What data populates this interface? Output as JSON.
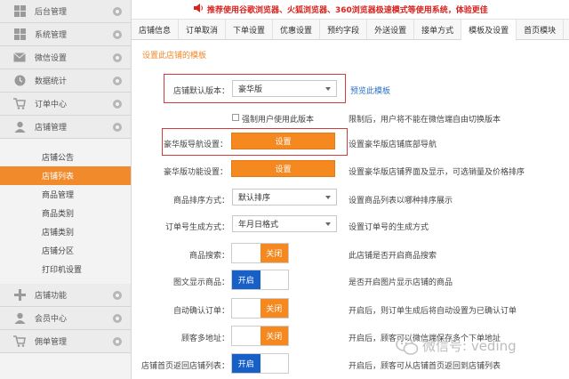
{
  "notice": {
    "text": "推荐使用谷歌浏览器、火狐浏览器、360浏览器极速模式等使用系统，体验更佳",
    "icon": "speaker-icon"
  },
  "sidebar": {
    "groups": [
      {
        "label": "后台管理",
        "icon": "grid-icon"
      },
      {
        "label": "系统管理",
        "icon": "grid-icon"
      },
      {
        "label": "微信设置",
        "icon": "mail-icon"
      },
      {
        "label": "数据统计",
        "icon": "clock-icon"
      },
      {
        "label": "订单中心",
        "icon": "cart-icon"
      },
      {
        "label": "店铺管理",
        "icon": "user-icon"
      }
    ],
    "sub_items": [
      "店铺公告",
      "店铺列表",
      "商品管理",
      "商品类别",
      "店铺类别",
      "店铺分区",
      "打印机设置"
    ],
    "active_sub": "店铺列表",
    "bottom_groups": [
      {
        "label": "店铺功能",
        "icon": "plus-icon"
      },
      {
        "label": "会员中心",
        "icon": "user-icon"
      },
      {
        "label": "佣单管理",
        "icon": "cart-icon"
      }
    ]
  },
  "tabs": [
    "店铺信息",
    "订单取消",
    "下单设置",
    "优惠设置",
    "预约字段",
    "外送设置",
    "接单方式",
    "模板及设置",
    "首页模块"
  ],
  "active_tab": "模板及设置",
  "section_link": "设置此店铺的模板",
  "form": {
    "default_version": {
      "label": "店铺默认版本：",
      "value": "豪华版",
      "preview_link": "预览此模板"
    },
    "force_version": {
      "label": "强制用户使用此版本",
      "desc": "限制后，用户将不能在微信端自由切换版本"
    },
    "nav_setting": {
      "label": "豪华版导航设置：",
      "button": "设置",
      "desc": "设置豪华版店铺底部导航"
    },
    "func_setting": {
      "label": "豪华版功能设置：",
      "button": "设置",
      "desc": "设置豪华版店铺界面及显示，可选销量及价格排序"
    },
    "sort_mode": {
      "label": "商品排序方式：",
      "value": "默认排序",
      "desc": "设置商品列表以哪种排序展示"
    },
    "order_format": {
      "label": "订单号生成方式：",
      "value": "年月日格式",
      "desc": "设置订单号的生成方式"
    },
    "product_search": {
      "label": "商品搜索：",
      "state": "关闭",
      "on": false,
      "desc": "此店铺是否开启商品搜索"
    },
    "image_display": {
      "label": "图文显示商品：",
      "state": "开启",
      "on": true,
      "desc": "是否开启图片显示店铺的商品"
    },
    "auto_confirm": {
      "label": "自动确认订单：",
      "state": "关闭",
      "on": false,
      "desc": "开启后，则订单生成后将自动设置为已确认订单"
    },
    "multi_address": {
      "label": "顾客多地址：",
      "state": "关闭",
      "on": false,
      "desc": "开启后，顾客可以微信端保存多个下单地址"
    },
    "return_list": {
      "label": "店铺首页返回店铺列表：",
      "state": "开启",
      "on": true,
      "desc": "开启后，顾客可从店铺首页返回到店铺列表"
    }
  },
  "watermark": {
    "text": "微信号: veding",
    "icon": "wechat-icon"
  },
  "colors": {
    "accent": "#f08a2b",
    "button": "#f5891f",
    "toggle_on": "#1660c7",
    "notice": "#d9231f",
    "link": "#2c72c7",
    "highlight": "#d43b3b"
  }
}
